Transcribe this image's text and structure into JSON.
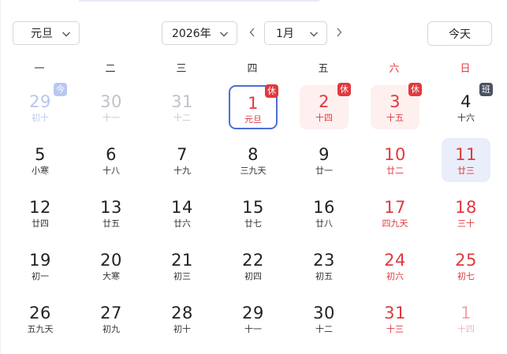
{
  "toolbar": {
    "holiday_select": "元旦",
    "year_select": "2026年",
    "month_select": "1月",
    "today_button": "今天"
  },
  "weekdays": [
    "一",
    "二",
    "三",
    "四",
    "五",
    "六",
    "日"
  ],
  "badge_labels": {
    "rest": "休",
    "work": "班",
    "today": "今"
  },
  "colors": {
    "accent": "#4a6fd6",
    "holiday_red": "#e0393e",
    "work_badge": "#4b5062",
    "rest_bg": "#fdf0ef",
    "selected_bg": "#eaeefa"
  },
  "weeks": [
    [
      {
        "day": "29",
        "lunar": "初十",
        "other": true,
        "badge": "今",
        "badge_type": "jin"
      },
      {
        "day": "30",
        "lunar": "十一",
        "other": true
      },
      {
        "day": "31",
        "lunar": "十二",
        "other": true
      },
      {
        "day": "1",
        "lunar": "元旦",
        "badge": "休",
        "badge_type": "rest",
        "state": "today",
        "red": true
      },
      {
        "day": "2",
        "lunar": "十四",
        "badge": "休",
        "badge_type": "rest",
        "state": "rest",
        "red": true
      },
      {
        "day": "3",
        "lunar": "十五",
        "badge": "休",
        "badge_type": "rest",
        "state": "rest",
        "red": true
      },
      {
        "day": "4",
        "lunar": "十六",
        "badge": "班",
        "badge_type": "work"
      }
    ],
    [
      {
        "day": "5",
        "lunar": "小寒"
      },
      {
        "day": "6",
        "lunar": "十八"
      },
      {
        "day": "7",
        "lunar": "十九"
      },
      {
        "day": "8",
        "lunar": "三九天"
      },
      {
        "day": "9",
        "lunar": "廿一"
      },
      {
        "day": "10",
        "lunar": "廿二",
        "weekend": true
      },
      {
        "day": "11",
        "lunar": "廿三",
        "weekend": true,
        "state": "selected"
      }
    ],
    [
      {
        "day": "12",
        "lunar": "廿四"
      },
      {
        "day": "13",
        "lunar": "廿五"
      },
      {
        "day": "14",
        "lunar": "廿六"
      },
      {
        "day": "15",
        "lunar": "廿七"
      },
      {
        "day": "16",
        "lunar": "廿八"
      },
      {
        "day": "17",
        "lunar": "四九天",
        "weekend": true
      },
      {
        "day": "18",
        "lunar": "三十",
        "weekend": true
      }
    ],
    [
      {
        "day": "19",
        "lunar": "初一"
      },
      {
        "day": "20",
        "lunar": "大寒"
      },
      {
        "day": "21",
        "lunar": "初三"
      },
      {
        "day": "22",
        "lunar": "初四"
      },
      {
        "day": "23",
        "lunar": "初五"
      },
      {
        "day": "24",
        "lunar": "初六",
        "weekend": true
      },
      {
        "day": "25",
        "lunar": "初七",
        "weekend": true
      }
    ],
    [
      {
        "day": "26",
        "lunar": "五九天"
      },
      {
        "day": "27",
        "lunar": "初九"
      },
      {
        "day": "28",
        "lunar": "初十"
      },
      {
        "day": "29",
        "lunar": "十一"
      },
      {
        "day": "30",
        "lunar": "十二"
      },
      {
        "day": "31",
        "lunar": "十三",
        "weekend": true
      },
      {
        "day": "1",
        "lunar": "十四",
        "weekend": true,
        "other": true
      }
    ]
  ]
}
